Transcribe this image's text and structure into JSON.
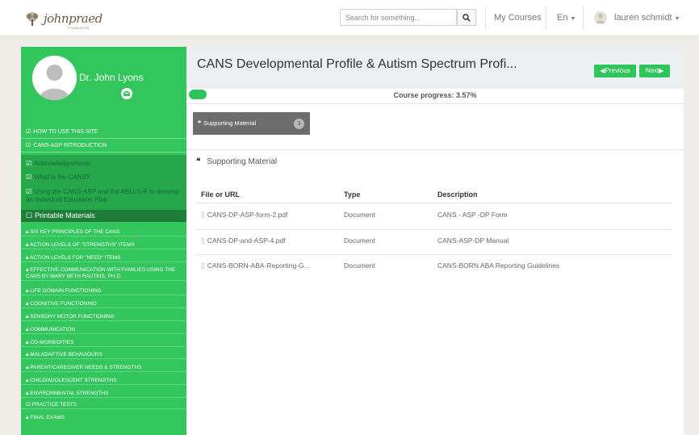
{
  "header": {
    "logo_text": "johnpraed",
    "logo_sub": "FOUNDATION",
    "search_placeholder": "Search for something...",
    "my_courses": "My Courses",
    "language": "En",
    "user_name": "lauren schmidt"
  },
  "sidebar": {
    "profile_name": "Dr. John Lyons",
    "top_items": [
      {
        "label": "HOW TO USE THIS SITE",
        "icon": "check-square-icon"
      },
      {
        "label": "CANS-ASP INTRODUCTION",
        "icon": "check-square-icon"
      }
    ],
    "sub_items": [
      {
        "label": "Acknowledgements",
        "icon": "check-square-icon"
      },
      {
        "label": "What is the CANS?",
        "icon": "check-square-icon"
      },
      {
        "label": "Using the CANS-ASP and the ABLLS-R to develop an Individual Education Plan",
        "icon": "check-square-icon"
      }
    ],
    "active_item": "Printable Materials",
    "locked_items": [
      "SIX KEY PRINCIPLES OF THE CANS",
      "ACTION LEVELS OF \"STRENGTHS\" ITEMS",
      "ACTION LEVELS FOR \"NEED\" ITEMS",
      "EFFECTIVE COMMUNICATION WITH FAMILIES USING THE CANS BY MARY BETH RAUTKIS, PH.D.",
      "LIFE DOMAIN FUNCTIONING",
      "COGNITIVE FUNCTIONING",
      "SENSORY MOTOR FUNCTIONING",
      "COMMUNICATION",
      "CO-MORBIDITIES",
      "MALADAPTIVE BEHAVIOURS",
      "PARENT/CAREGIVER NEEDS & STRENGTHS",
      "CHILD/ADOLESCENT STRENGTHS",
      "ENVIRONMENTAL STRENGTHS"
    ],
    "practice_tests": "PRACTICE TESTS",
    "final_exams": "FINAL EXAMS"
  },
  "main": {
    "title": "CANS Developmental Profile & Autism Spectrum Profi...",
    "prev_label": "Previous",
    "next_label": "Next",
    "progress_label": "Course progress: 3.57%",
    "progress_value": 3.57,
    "tab_label": "Supporting Material",
    "tab_count": "3",
    "section_title": "Supporting Material",
    "columns": [
      "File or URL",
      "Type",
      "Description"
    ],
    "rows": [
      {
        "file": "CANS-DP-ASP-form-2.pdf",
        "type": "Document",
        "description": "CANS - ASP -DP Form"
      },
      {
        "file": "CANS-DP-and-ASP-4.pdf",
        "type": "Document",
        "description": "CANS-ASP-DP Manual"
      },
      {
        "file": "CANS-BORN-ABA-Reporting-G...",
        "type": "Document",
        "description": "CANS-BORN ABA Reporting Guidelines"
      }
    ]
  },
  "colors": {
    "sidebar_green": "#33c65c",
    "sidebar_dark": "#25a74a",
    "active_green": "#1d7d39",
    "button_green": "#2ec55a",
    "tab_gray": "#6d6d6d"
  }
}
